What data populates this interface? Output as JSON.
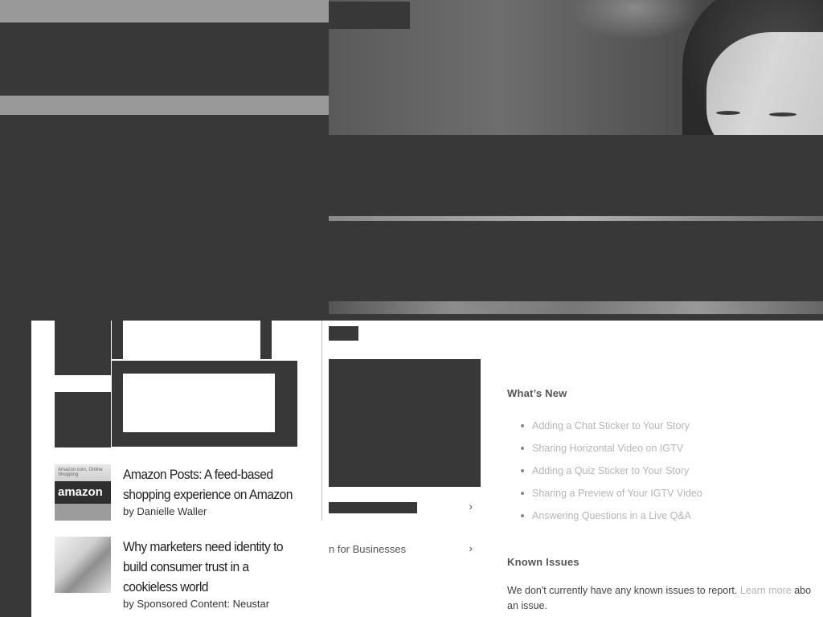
{
  "sidebar_articles": [
    {
      "title": "Amazon Posts: A feed-based shopping experience on Amazon",
      "byline": "by Danielle Waller",
      "thumb_icon": "amazon-thumbnail"
    },
    {
      "title": "Why marketers need identity to build consumer trust in a cookieless world",
      "byline": "by Sponsored Content: Neustar",
      "thumb_icon": "hand-typing-thumbnail"
    }
  ],
  "thumb_amazon_texts": {
    "logo": "amazon",
    "small": "Amazon.com, Online Shopping"
  },
  "help_nav": {
    "partial_item": "n for Businesses"
  },
  "whats_new": {
    "heading": "What’s New",
    "items": [
      "Adding a Chat Sticker to Your Story",
      "Sharing Horizontal Video on IGTV",
      "Adding a Quiz Sticker to Your Story",
      "Sharing a Preview of Your IGTV Video",
      "Answering Questions in a Live Q&A"
    ]
  },
  "known_issues": {
    "heading": "Known Issues",
    "text_before": "We don't currently have any known issues to report. ",
    "link": "Learn more",
    "text_after": " abo",
    "text_line2": "an issue."
  },
  "colors": {
    "overlay": "#383838",
    "muted_link": "#b5b5b5",
    "divider": "#bbbbbb"
  }
}
